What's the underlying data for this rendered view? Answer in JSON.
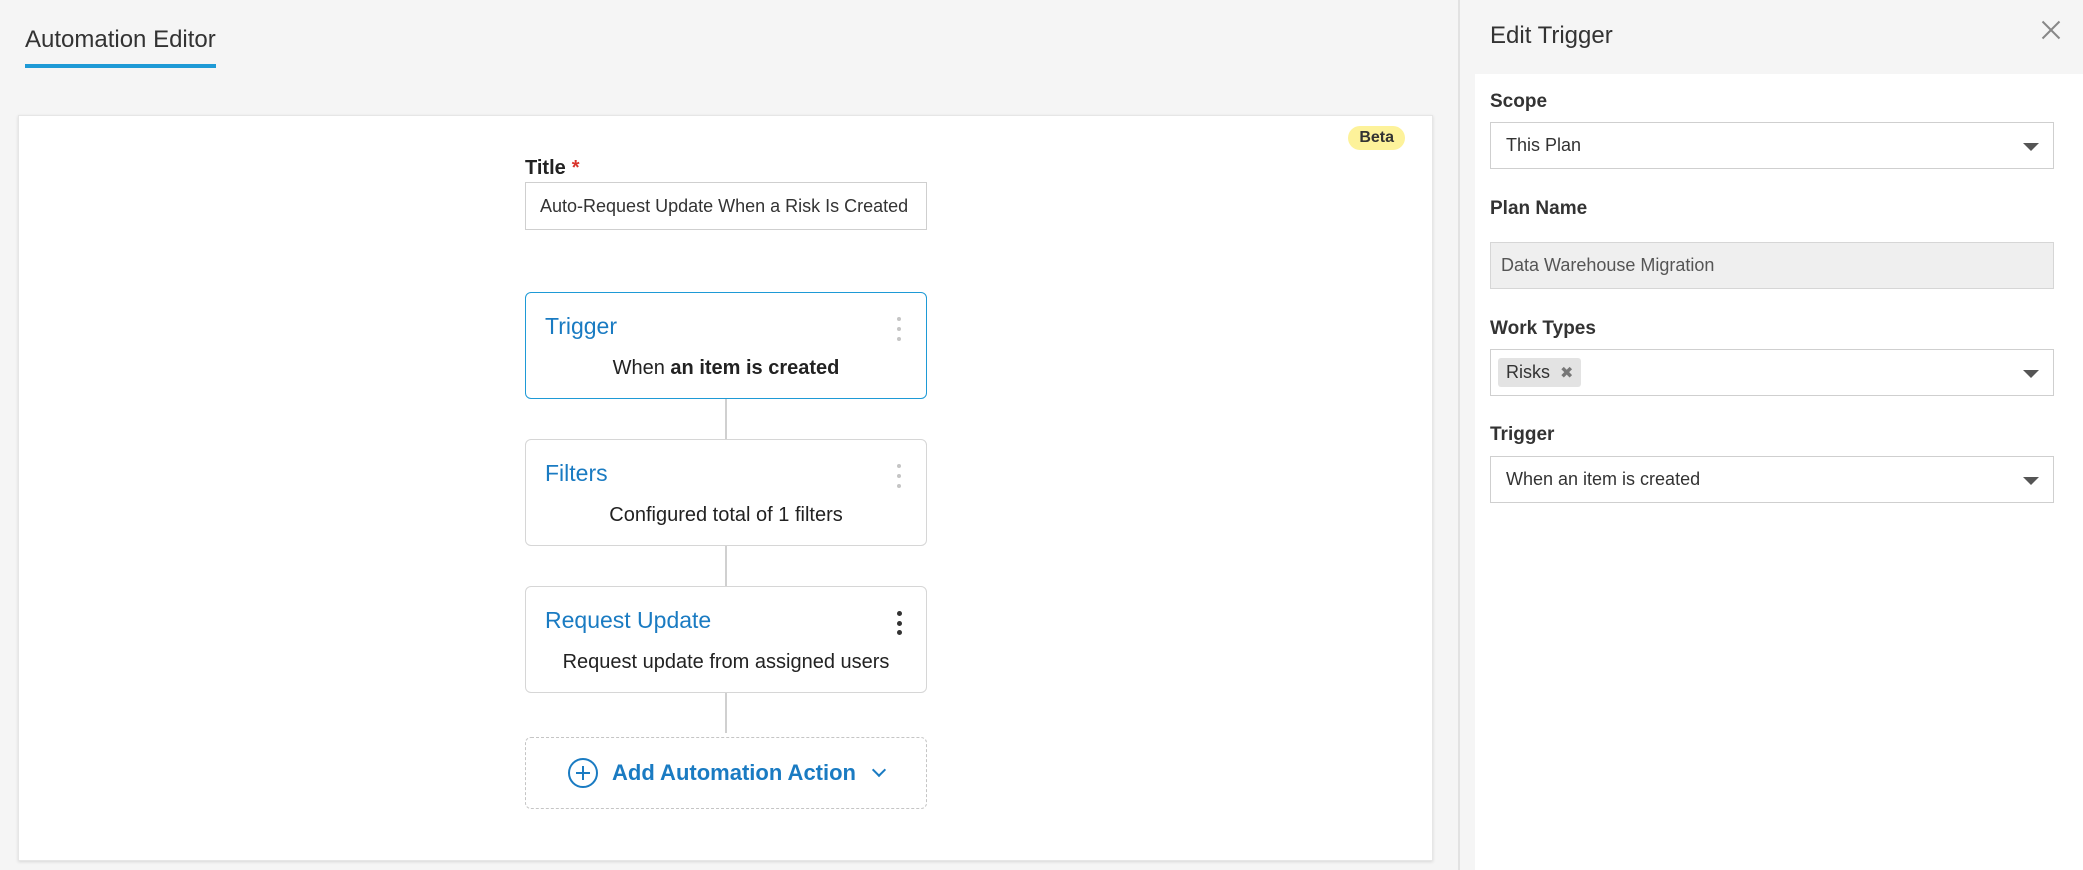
{
  "header": {
    "tab_label": "Automation Editor"
  },
  "canvas": {
    "beta_badge": "Beta",
    "title_label": "Title",
    "title_required_marker": "*",
    "title_value": "Auto-Request Update When a Risk Is Created",
    "cards": [
      {
        "title": "Trigger",
        "desc_prefix": "When ",
        "desc_bold": "an item is created"
      },
      {
        "title": "Filters",
        "desc": "Configured total of 1 filters"
      },
      {
        "title": "Request Update",
        "desc": "Request update from assigned users"
      }
    ],
    "add_action_label": "Add Automation Action"
  },
  "panel": {
    "title": "Edit Trigger",
    "scope": {
      "label": "Scope",
      "value": "This Plan"
    },
    "plan_name": {
      "label": "Plan Name",
      "value": "Data Warehouse Migration"
    },
    "work_types": {
      "label": "Work Types",
      "tags": [
        "Risks"
      ],
      "tag_remove": "✖"
    },
    "trigger": {
      "label": "Trigger",
      "value": "When an item is created"
    }
  },
  "colors": {
    "accent": "#1e9ad6",
    "link": "#1a7bc2",
    "beta": "#fdf29a",
    "required": "#d9342b"
  }
}
